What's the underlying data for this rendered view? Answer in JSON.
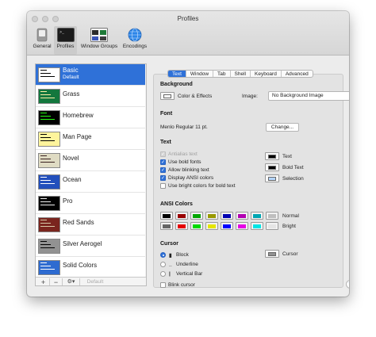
{
  "window": {
    "title": "Profiles"
  },
  "toolbar": {
    "items": [
      {
        "label": "General"
      },
      {
        "label": "Profiles"
      },
      {
        "label": "Window Groups"
      },
      {
        "label": "Encodings"
      }
    ]
  },
  "sidebar": {
    "profiles": [
      {
        "name": "Basic",
        "subtitle": "Default",
        "bg": "#ffffff",
        "fg": "#000000"
      },
      {
        "name": "Grass",
        "bg": "#13773d",
        "fg": "#fff0a5"
      },
      {
        "name": "Homebrew",
        "bg": "#000000",
        "fg": "#28fe14"
      },
      {
        "name": "Man Page",
        "bg": "#fef49c",
        "fg": "#000000"
      },
      {
        "name": "Novel",
        "bg": "#dfdbc3",
        "fg": "#3b2322"
      },
      {
        "name": "Ocean",
        "bg": "#224fbc",
        "fg": "#ffffff"
      },
      {
        "name": "Pro",
        "bg": "#000000",
        "fg": "#f2f2f2"
      },
      {
        "name": "Red Sands",
        "bg": "#7a251e",
        "fg": "#d7c9a7"
      },
      {
        "name": "Silver Aerogel",
        "bg": "#929292",
        "fg": "#000000"
      },
      {
        "name": "Solid Colors",
        "bg": "#2e6bd0",
        "fg": "#ffffff"
      }
    ],
    "add_label": "+",
    "remove_label": "−",
    "gear_label": "⚙▾",
    "default_label": "Default"
  },
  "tabs": [
    "Text",
    "Window",
    "Tab",
    "Shell",
    "Keyboard",
    "Advanced"
  ],
  "selected_tab": "Text",
  "background": {
    "heading": "Background",
    "color_effects_label": "Color & Effects",
    "image_label": "Image:",
    "image_value": "No Background Image",
    "image_arrow": "⬍"
  },
  "font": {
    "heading": "Font",
    "value": "Menlo Regular 11 pt.",
    "change_button": "Change..."
  },
  "text": {
    "heading": "Text",
    "options": [
      {
        "label": "Antialias text",
        "checked": true,
        "enabled": false
      },
      {
        "label": "Use bold fonts",
        "checked": true,
        "enabled": true
      },
      {
        "label": "Allow blinking text",
        "checked": true,
        "enabled": true
      },
      {
        "label": "Display ANSI colors",
        "checked": true,
        "enabled": true
      },
      {
        "label": "Use bright colors for bold text",
        "checked": false,
        "enabled": true
      }
    ],
    "wells": [
      {
        "label": "Text",
        "color": "#000000"
      },
      {
        "label": "Bold Text",
        "color": "#000000"
      },
      {
        "label": "Selection",
        "color": "#b4d5fe"
      }
    ]
  },
  "ansi": {
    "heading": "ANSI Colors",
    "normal_label": "Normal",
    "bright_label": "Bright",
    "normal": [
      "#000000",
      "#990000",
      "#00a600",
      "#999900",
      "#0000b2",
      "#b200b2",
      "#00a6b2",
      "#bfbfbf"
    ],
    "bright": [
      "#666666",
      "#e50000",
      "#00d900",
      "#e5e500",
      "#0000ff",
      "#e500e5",
      "#00e5e5",
      "#e5e5e5"
    ]
  },
  "cursor": {
    "heading": "Cursor",
    "options": [
      {
        "label": "Block",
        "glyph": "▮",
        "selected": true
      },
      {
        "label": "Underline",
        "glyph": "_",
        "selected": false
      },
      {
        "label": "Vertical Bar",
        "glyph": "|",
        "selected": false
      }
    ],
    "blink_label": "Blink cursor",
    "well_label": "Cursor",
    "well_color": "#929292"
  },
  "help_label": "?"
}
